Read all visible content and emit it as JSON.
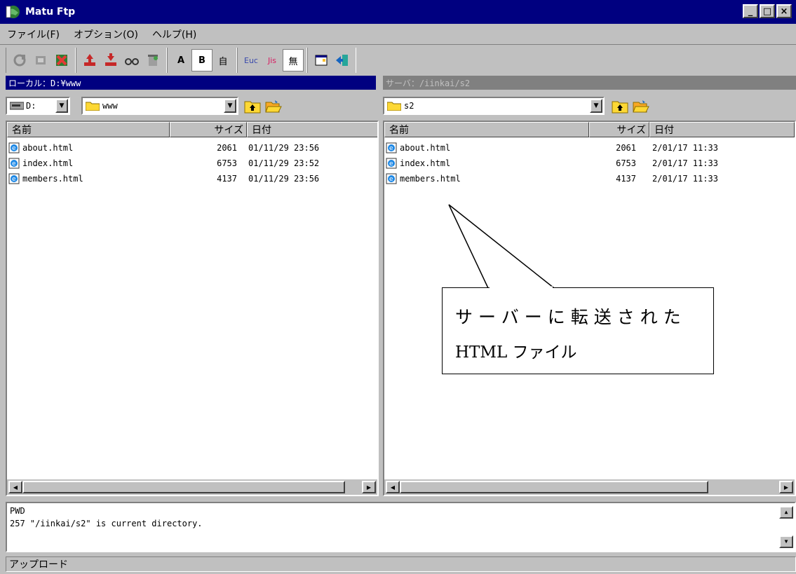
{
  "window": {
    "title": "Matu Ftp"
  },
  "menu": {
    "items": [
      "ファイル(F)",
      "オプション(O)",
      "ヘルプ(H)"
    ]
  },
  "toolbar": {
    "btn_a": "A",
    "btn_b": "B",
    "btn_auto": "自",
    "btn_euc": "Euc",
    "btn_jis": "Jis",
    "btn_none": "無"
  },
  "local": {
    "path": "ローカル：D:¥www",
    "drive": "D:",
    "folder": "www",
    "columns": {
      "name": "名前",
      "size": "サイズ",
      "date": "日付"
    },
    "files": [
      {
        "name": "about.html",
        "size": "2061",
        "date": "01/11/29 23:56"
      },
      {
        "name": "index.html",
        "size": "6753",
        "date": "01/11/29 23:52"
      },
      {
        "name": "members.html",
        "size": "4137",
        "date": "01/11/29 23:56"
      }
    ]
  },
  "remote": {
    "path": "サーバ：/iinkai/s2",
    "folder": "s2",
    "columns": {
      "name": "名前",
      "size": "サイズ",
      "date": "日付"
    },
    "files": [
      {
        "name": "about.html",
        "size": "2061",
        "date": "2/01/17 11:33"
      },
      {
        "name": "index.html",
        "size": "6753",
        "date": "2/01/17 11:33"
      },
      {
        "name": "members.html",
        "size": "4137",
        "date": "2/01/17 11:33"
      }
    ]
  },
  "log": {
    "lines": [
      "PWD",
      "257 \"/iinkai/s2\" is current directory."
    ]
  },
  "status": {
    "text": "アップロード"
  },
  "callout": {
    "line1": "サーバーに転送された",
    "line2": "HTML ファイル"
  },
  "icons": {
    "app": "globe-app-icon",
    "file": "ie-html-file-icon",
    "folder": "folder-icon",
    "drive": "drive-icon",
    "up": "folder-up-icon",
    "open": "folder-open-icon"
  },
  "colors": {
    "titlebar": "#000080",
    "inactive_path": "#808080",
    "face": "#c0c0c0"
  }
}
